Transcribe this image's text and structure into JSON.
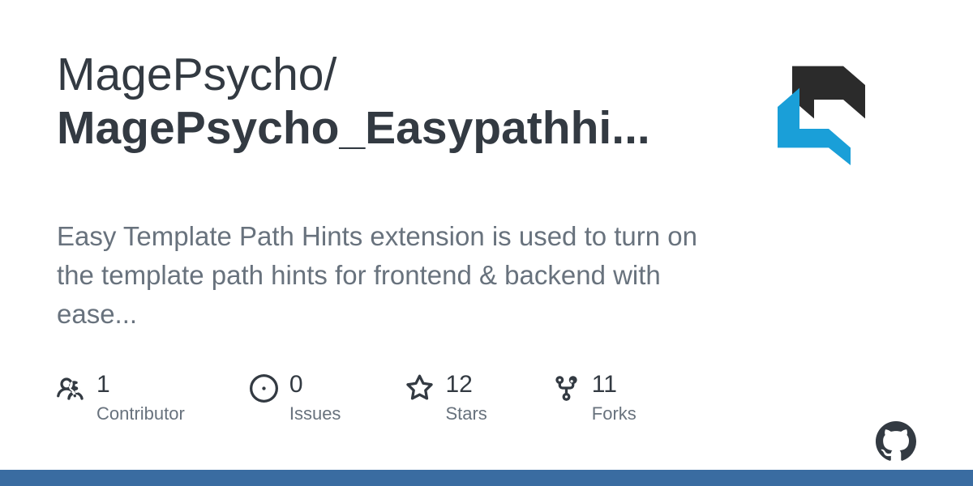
{
  "repo": {
    "owner": "MagePsycho/",
    "name": "MagePsycho_Easypathhi..."
  },
  "description": "Easy Template Path Hints extension is used to turn on the template path hints for frontend & backend with ease...",
  "stats": {
    "contributors": {
      "count": "1",
      "label": "Contributor"
    },
    "issues": {
      "count": "0",
      "label": "Issues"
    },
    "stars": {
      "count": "12",
      "label": "Stars"
    },
    "forks": {
      "count": "11",
      "label": "Forks"
    }
  }
}
